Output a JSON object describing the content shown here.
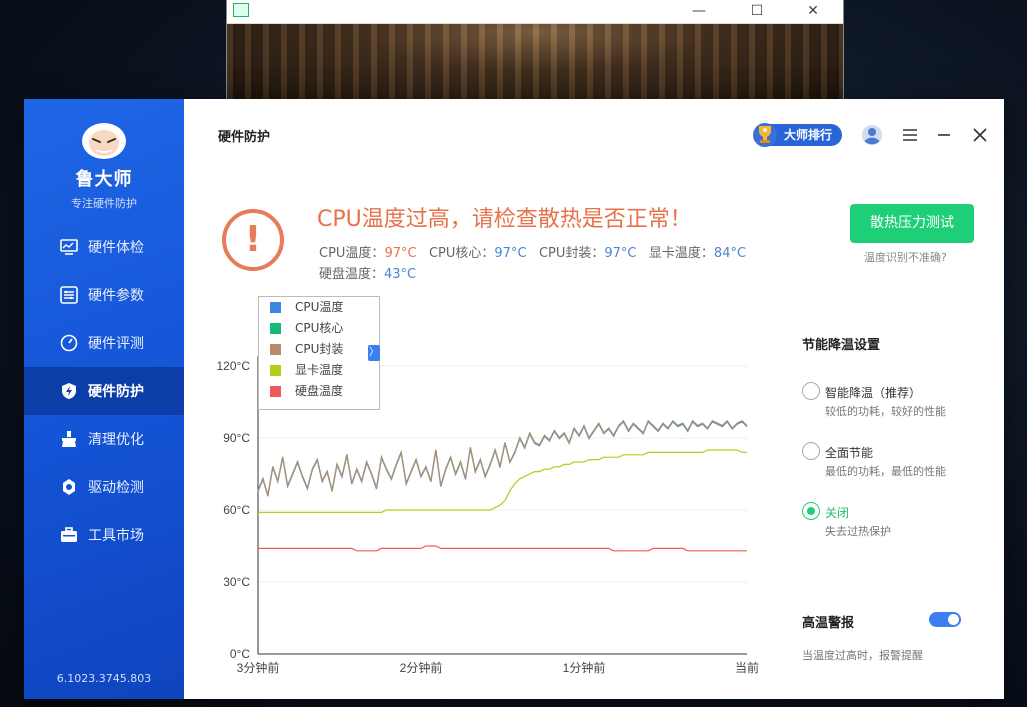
{
  "colors": {
    "sidebar": "#1453d6",
    "accent_blue": "#3d7ff2",
    "alert_orange": "#e8714a",
    "button_green": "#1fcf78",
    "series": [
      "#3a86e0",
      "#17b978",
      "#b98a6e",
      "#b5cc18",
      "#f05a5a"
    ]
  },
  "sidebar": {
    "logo_title": "鲁大师",
    "logo_sub": "专注硬件防护",
    "items": [
      {
        "label": "硬件体检",
        "icon": "monitor-icon"
      },
      {
        "label": "硬件参数",
        "icon": "list-icon"
      },
      {
        "label": "硬件评测",
        "icon": "speedometer-icon"
      },
      {
        "label": "硬件防护",
        "icon": "shield-bolt-icon"
      },
      {
        "label": "清理优化",
        "icon": "broom-icon"
      },
      {
        "label": "驱动检测",
        "icon": "gear-icon"
      },
      {
        "label": "工具市场",
        "icon": "toolbox-icon"
      }
    ],
    "active_index": 3,
    "version": "6.1023.3745.803"
  },
  "header": {
    "title": "硬件防护",
    "rank_label": "大师排行"
  },
  "alert": {
    "title": "CPU温度过高，请检查散热是否正常！",
    "temps": {
      "cpu_label": "CPU温度：",
      "cpu_value": "97°C",
      "core_label": "CPU核心：",
      "core_value": "97°C",
      "pkg_label": "CPU封装：",
      "pkg_value": "97°C",
      "gpu_label": "显卡温度：",
      "gpu_value": "84°C",
      "disk_label": "硬盘温度：",
      "disk_value": "43°C"
    },
    "stress_button": "散热压力测试",
    "not_accurate": "温度识别不准确?"
  },
  "chart_data": {
    "type": "line",
    "yticks": [
      "120°C",
      "90°C",
      "60°C",
      "30°C",
      "0°C"
    ],
    "ylim": [
      0,
      120
    ],
    "xticks": [
      "3分钟前",
      "2分钟前",
      "1分钟前",
      "当前"
    ],
    "legend_placement": "top-left",
    "grid": true,
    "series": [
      {
        "name": "CPU温度",
        "color": "#3a86e0"
      },
      {
        "name": "CPU核心",
        "color": "#17b978"
      },
      {
        "name": "CPU封装",
        "color": "#b98a6e"
      },
      {
        "name": "显卡温度",
        "color": "#b5cc18"
      },
      {
        "name": "硬盘温度",
        "color": "#f05a5a"
      }
    ],
    "cpu_values": [
      68,
      73,
      66,
      78,
      72,
      82,
      70,
      75,
      80,
      74,
      69,
      77,
      81,
      72,
      76,
      68,
      79,
      74,
      83,
      71,
      77,
      72,
      80,
      75,
      69,
      82,
      77,
      73,
      79,
      84,
      71,
      76,
      81,
      74,
      78,
      72,
      85,
      70,
      77,
      82,
      75,
      80,
      73,
      86,
      76,
      81,
      74,
      79,
      85,
      78,
      88,
      80,
      84,
      90,
      86,
      92,
      88,
      87,
      91,
      89,
      93,
      90,
      92,
      88,
      94,
      91,
      95,
      90,
      93,
      96,
      92,
      94,
      91,
      95,
      97,
      93,
      96,
      94,
      92,
      97,
      95,
      93,
      96,
      94,
      97,
      95,
      96,
      93,
      97,
      95,
      96,
      94,
      97,
      96,
      95,
      97,
      94,
      96,
      97,
      95
    ],
    "gpu_values": [
      59,
      59,
      59,
      59,
      59,
      59,
      59,
      59,
      59,
      59,
      59,
      59,
      59,
      59,
      59,
      59,
      59,
      59,
      59,
      59,
      59,
      59,
      59,
      59,
      59,
      59,
      60,
      60,
      60,
      60,
      60,
      60,
      60,
      60,
      60,
      60,
      60,
      60,
      60,
      60,
      60,
      60,
      60,
      60,
      60,
      60,
      60,
      60,
      61,
      62,
      64,
      68,
      71,
      73,
      74,
      75,
      76,
      76,
      77,
      77,
      78,
      78,
      79,
      79,
      80,
      80,
      80,
      81,
      81,
      81,
      82,
      82,
      82,
      82,
      83,
      83,
      83,
      83,
      83,
      84,
      84,
      84,
      84,
      84,
      84,
      84,
      84,
      84,
      84,
      84,
      84,
      85,
      85,
      85,
      85,
      85,
      85,
      85,
      84,
      84
    ],
    "disk_values": [
      44,
      44,
      44,
      44,
      44,
      44,
      44,
      44,
      44,
      44,
      44,
      44,
      44,
      44,
      44,
      44,
      44,
      44,
      44,
      44,
      43,
      43,
      43,
      43,
      43,
      44,
      44,
      44,
      44,
      44,
      44,
      44,
      44,
      44,
      45,
      45,
      45,
      44,
      44,
      44,
      44,
      44,
      44,
      44,
      44,
      44,
      44,
      44,
      44,
      44,
      44,
      44,
      44,
      44,
      44,
      44,
      44,
      44,
      44,
      44,
      44,
      44,
      44,
      44,
      44,
      44,
      44,
      44,
      44,
      44,
      44,
      44,
      43,
      43,
      43,
      43,
      43,
      43,
      43,
      43,
      44,
      44,
      44,
      44,
      44,
      44,
      44,
      43,
      43,
      43,
      43,
      43,
      43,
      43,
      43,
      43,
      43,
      43,
      43,
      43
    ]
  },
  "settings": {
    "title": "节能降温设置",
    "options": [
      {
        "label": "智能降温（推荐）",
        "desc": "较低的功耗，较好的性能",
        "selected": false
      },
      {
        "label": "全面节能",
        "desc": "最低的功耗，最低的性能",
        "selected": false
      },
      {
        "label": "关闭",
        "desc": "失去过热保护",
        "selected": true
      }
    ],
    "alarm_title": "高温警报",
    "alarm_on": true,
    "alarm_desc": "当温度过高时，报警提醒"
  }
}
